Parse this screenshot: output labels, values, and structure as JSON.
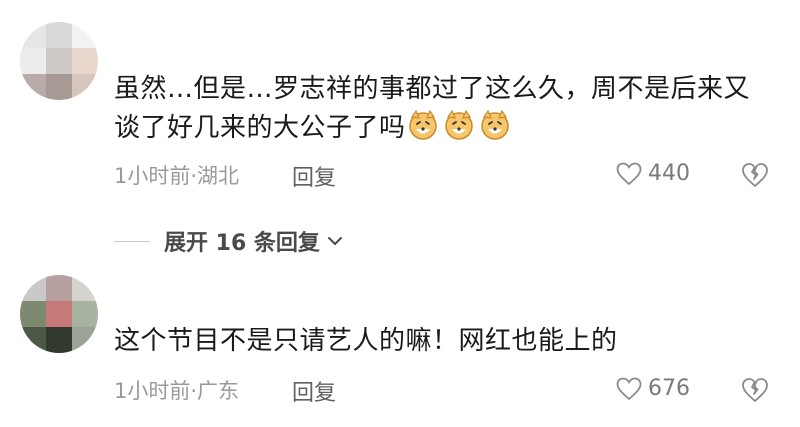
{
  "comments": [
    {
      "text": "虽然…但是…罗志祥的事都过了这么久，周不是后来又谈了好几来的大公子了吗",
      "emojis": [
        "shiba-dog-emoji",
        "shiba-dog-emoji",
        "shiba-dog-emoji"
      ],
      "meta": "1小时前·湖北",
      "reply_label": "回复",
      "likes": "440",
      "expand_label": "展开 16 条回复"
    },
    {
      "text": "这个节目不是只请艺人的嘛！网红也能上的",
      "meta": "1小时前·广东",
      "reply_label": "回复",
      "likes": "676"
    }
  ],
  "icons": {
    "like": "heart-outline-icon",
    "dislike": "broken-heart-icon",
    "expand": "chevron-down-icon"
  },
  "colors": {
    "text": "#1a1a1a",
    "meta": "#9a9a9a",
    "action": "#606060"
  }
}
